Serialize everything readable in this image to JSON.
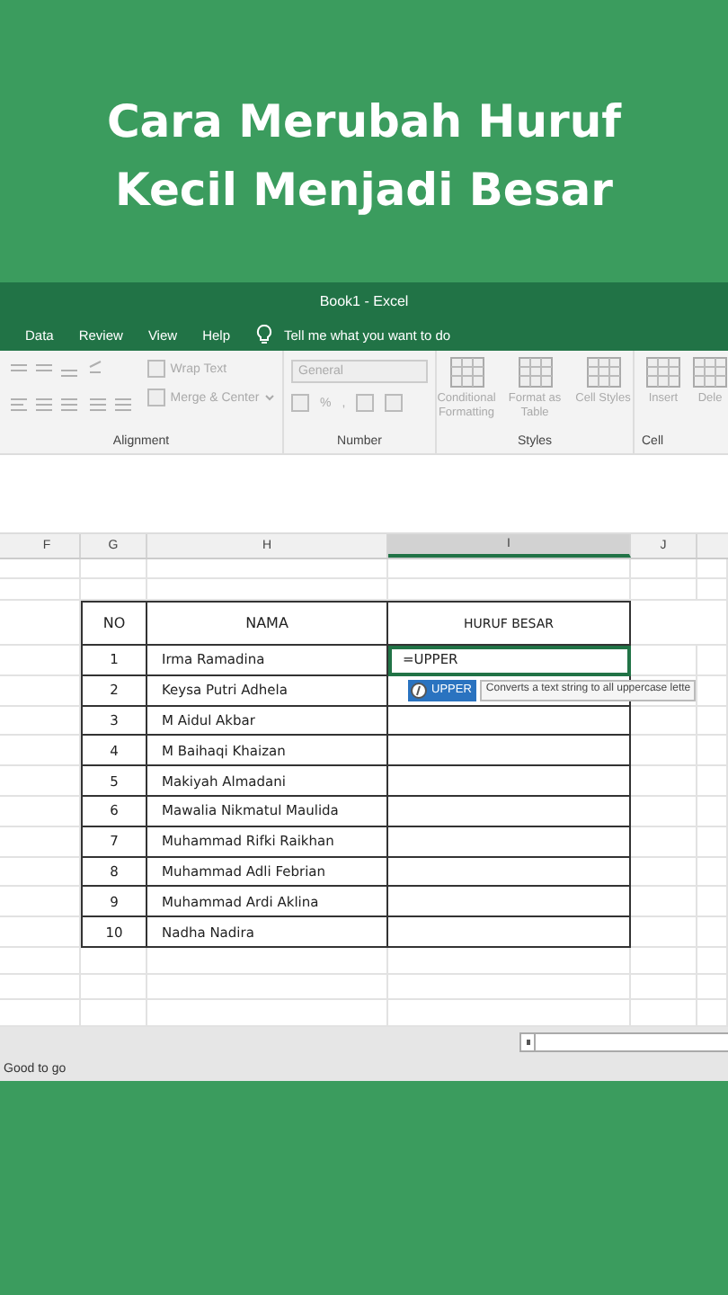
{
  "video_title": [
    "Cara Merubah Huruf",
    "Kecil Menjadi Besar"
  ],
  "window": {
    "title": "Book1  -  Excel"
  },
  "menu": [
    {
      "label": "Data"
    },
    {
      "label": "Review"
    },
    {
      "label": "View"
    },
    {
      "label": "Help"
    }
  ],
  "tell_me": "Tell me what you want to do",
  "ribbon": {
    "groups": [
      {
        "kind": "alignment",
        "label": "Alignment",
        "items": [
          "Wrap Text",
          "Merge & Center"
        ]
      },
      {
        "kind": "number",
        "label": "Number",
        "items": [
          "General",
          "%",
          ","
        ]
      },
      {
        "kind": "styles",
        "label": "Styles",
        "items": [
          "Conditional Formatting",
          "Format as Table",
          "Cell Styles"
        ]
      },
      {
        "kind": "cells",
        "label": "Cell",
        "items": [
          "Insert",
          "Dele"
        ]
      }
    ]
  },
  "columns": [
    {
      "label": "F",
      "selected": false
    },
    {
      "label": "G",
      "selected": false
    },
    {
      "label": "H",
      "selected": false
    },
    {
      "label": "I",
      "selected": true
    },
    {
      "label": "J",
      "selected": false
    }
  ],
  "table": {
    "columns": [
      "NO",
      "NAMA",
      "HURUF BESAR"
    ],
    "rows": [
      {
        "no": "1",
        "nama": "Irma Ramadina",
        "huruf_besar": "=UPPER",
        "active": true
      },
      {
        "no": "2",
        "nama": "Keysa Putri Adhela",
        "huruf_besar": "",
        "active": false
      },
      {
        "no": "3",
        "nama": "M Aidul Akbar",
        "huruf_besar": "",
        "active": false
      },
      {
        "no": "4",
        "nama": "M Baihaqi Khaizan",
        "huruf_besar": "",
        "active": false
      },
      {
        "no": "5",
        "nama": "Makiyah Almadani",
        "huruf_besar": "",
        "active": false
      },
      {
        "no": "6",
        "nama": "Mawalia Nikmatul Maulida",
        "huruf_besar": "",
        "active": false
      },
      {
        "no": "7",
        "nama": "Muhammad Rifki Raikhan",
        "huruf_besar": "",
        "active": false
      },
      {
        "no": "8",
        "nama": "Muhammad Adli Febrian",
        "huruf_besar": "",
        "active": false
      },
      {
        "no": "9",
        "nama": "Muhammad Ardi Aklina",
        "huruf_besar": "",
        "active": false
      },
      {
        "no": "10",
        "nama": "Nadha Nadira",
        "huruf_besar": "",
        "active": false
      }
    ]
  },
  "autocomplete": {
    "function": "UPPER",
    "tooltip": "Converts a text string to all uppercase lette"
  },
  "status_bar": "Good to go"
}
